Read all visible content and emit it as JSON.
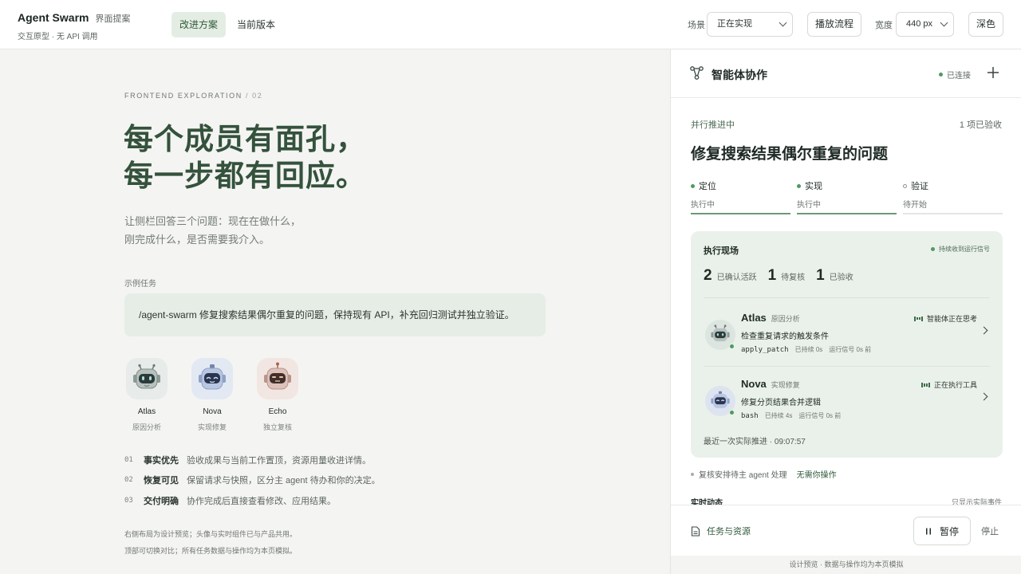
{
  "app": {
    "title": "Agent Swarm",
    "tag": "界面提案",
    "subtitle": "交互原型 · 无 API 调用"
  },
  "header": {
    "tabs": [
      {
        "label": "改进方案",
        "active": true
      },
      {
        "label": "当前版本",
        "active": false
      }
    ],
    "scene_label": "场景",
    "scene_value": "正在实现",
    "play_label": "播放流程",
    "width_label": "宽度",
    "width_value": "440 px",
    "theme_label": "深色"
  },
  "intro": {
    "eyebrow": "FRONTEND EXPLORATION",
    "eyebrow_num": "/ 02",
    "hero_line1": "每个成员有面孔，",
    "hero_line2": "每一步都有回应。",
    "lead_line1": "让侧栏回答三个问题：现在在做什么，",
    "lead_line2": "刚完成什么，是否需要我介入。",
    "example_label": "示例任务",
    "example_text": "/agent-swarm 修复搜索结果偶尔重复的问题，保持现有 API，补充回归测试并独立验证。"
  },
  "agents": [
    {
      "name": "Atlas",
      "role": "原因分析",
      "icon": "robot-atlas-icon",
      "color": "#e7ebe9"
    },
    {
      "name": "Nova",
      "role": "实现修复",
      "icon": "robot-nova-icon",
      "color": "#e3e9f3"
    },
    {
      "name": "Echo",
      "role": "独立复核",
      "icon": "robot-echo-icon",
      "color": "#f2e6e2"
    }
  ],
  "features": [
    {
      "num": "01",
      "title": "事实优先",
      "desc": "验收成果与当前工作置顶，资源用量收进详情。"
    },
    {
      "num": "02",
      "title": "恢复可见",
      "desc": "保留请求与快照，区分主 agent 待办和你的决定。"
    },
    {
      "num": "03",
      "title": "交付明确",
      "desc": "协作完成后直接查看修改、应用结果。"
    }
  ],
  "footnotes": [
    "右侧布局为设计预览；头像与实时组件已与产品共用。",
    "顶部可切换对比；所有任务数据与操作均为本页模拟。"
  ],
  "panel": {
    "title": "智能体协作",
    "connection": "已连接",
    "status": "并行推进中",
    "accepted": "1 项已验收",
    "task_title": "修复搜索结果偶尔重复的问题",
    "steps": [
      {
        "name": "定位",
        "state": "执行中",
        "active": true
      },
      {
        "name": "实现",
        "state": "执行中",
        "active": true
      },
      {
        "name": "验证",
        "state": "待开始",
        "active": false
      }
    ],
    "live": {
      "title": "执行现场",
      "signal": "持续收到运行信号",
      "metrics": [
        {
          "value": "2",
          "label": "已确认活跃"
        },
        {
          "value": "1",
          "label": "待复核"
        },
        {
          "value": "1",
          "label": "已验收"
        }
      ],
      "rows": [
        {
          "name": "Atlas",
          "role": "原因分析",
          "state": "智能体正在思考",
          "task": "检查重复请求的触发条件",
          "tool": "apply_patch",
          "duration": "已持续 0s",
          "signal": "运行信号 0s 前"
        },
        {
          "name": "Nova",
          "role": "实现修复",
          "state": "正在执行工具",
          "task": "修复分页结果合并逻辑",
          "tool": "bash",
          "duration": "已持续 4s",
          "signal": "运行信号 0s 前"
        }
      ],
      "last_push": "最近一次实际推进 · 09:07:57"
    },
    "review_note": "复核安排待主 agent 处理",
    "review_action": "无需你操作",
    "feed_title": "实时动态",
    "feed_note": "只显示实际事件",
    "resources_label": "任务与资源",
    "pause_label": "暂停",
    "stop_label": "停止",
    "credit": "设计预览 · 数据与操作均为本页模拟"
  }
}
